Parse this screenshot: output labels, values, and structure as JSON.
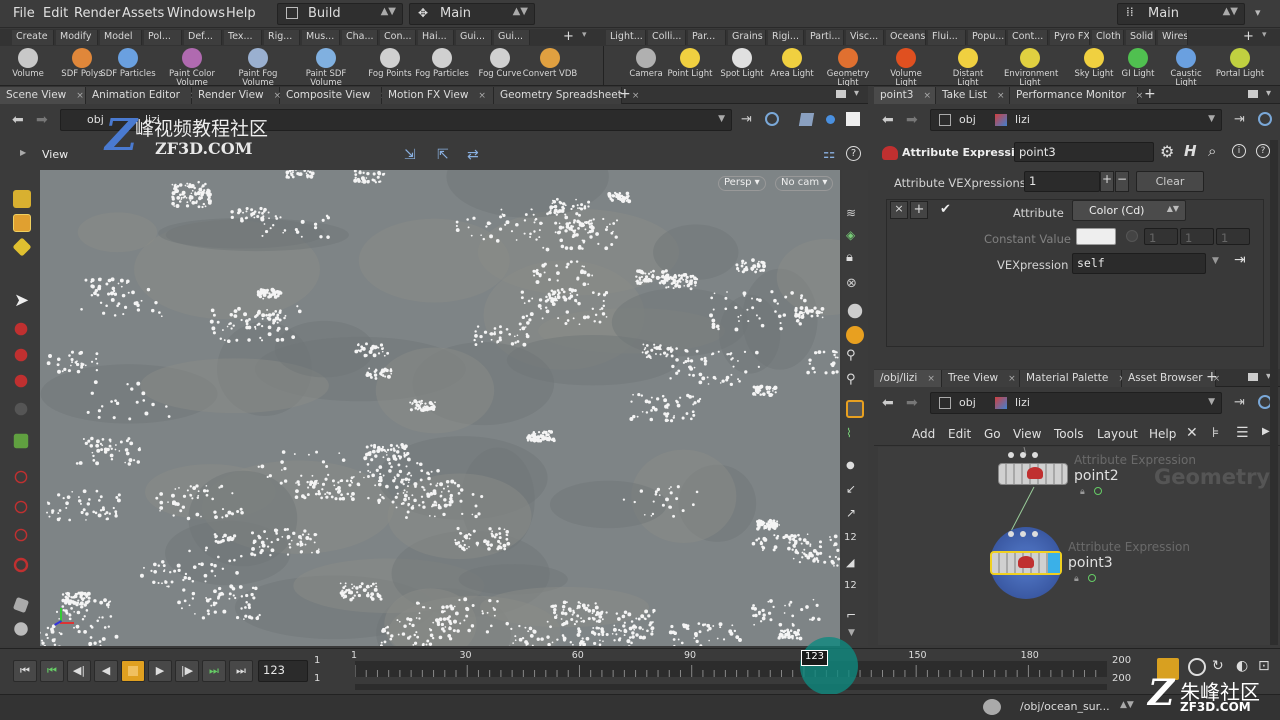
{
  "menubar": {
    "items": [
      "File",
      "Edit",
      "Render",
      "Assets",
      "Windows",
      "Help"
    ],
    "desktop": "Build",
    "context": "Main",
    "right": "Main"
  },
  "shelf_tabs_left": [
    "Create",
    "Modify",
    "Model",
    "Pol...",
    "Def...",
    "Tex...",
    "Rig...",
    "Mus...",
    "Cha...",
    "Con...",
    "Hai...",
    "Gui...",
    "Gui..."
  ],
  "shelf_tabs_right": [
    "Light...",
    "Colli...",
    "Par...",
    "Grains",
    "Rigi...",
    "Parti...",
    "Visc...",
    "Oceans",
    "Flui...",
    "Popu...",
    "Cont...",
    "Pyro FX",
    "Cloth",
    "Solid",
    "Wires"
  ],
  "tools_left": [
    {
      "label": "Volume",
      "color": "#c8c8c8"
    },
    {
      "label": "SDF Polys",
      "color": "#e0873a"
    },
    {
      "label": "SDF Particles",
      "color": "#6aa0e0"
    },
    {
      "label": "Paint Color Volume",
      "color": "#b06ab0"
    },
    {
      "label": "Paint Fog Volume",
      "color": "#9ab0d0"
    },
    {
      "label": "Paint SDF Volume",
      "color": "#80b0e0"
    },
    {
      "label": "Fog Points",
      "color": "#d0d0d0"
    },
    {
      "label": "Fog Particles",
      "color": "#d0d0d0"
    },
    {
      "label": "Fog Curve",
      "color": "#d0d0d0"
    },
    {
      "label": "Convert VDB",
      "color": "#e0a040"
    }
  ],
  "tools_right": [
    {
      "label": "Camera",
      "color": "#b0b0b0"
    },
    {
      "label": "Point Light",
      "color": "#f0d040"
    },
    {
      "label": "Spot Light",
      "color": "#e0e0e0"
    },
    {
      "label": "Area Light",
      "color": "#f0d040"
    },
    {
      "label": "Geometry Light",
      "color": "#e07030"
    },
    {
      "label": "Volume Light",
      "color": "#e05020"
    },
    {
      "label": "Distant Light",
      "color": "#f0d040"
    },
    {
      "label": "Environment Light",
      "color": "#e0d040"
    },
    {
      "label": "Sky Light",
      "color": "#f0d040"
    },
    {
      "label": "GI Light",
      "color": "#50c050"
    },
    {
      "label": "Caustic Light",
      "color": "#6aa0e0"
    },
    {
      "label": "Portal Light",
      "color": "#c0d040"
    }
  ],
  "left_pane": {
    "tabs": [
      "Scene View",
      "Animation Editor",
      "Render View",
      "Composite View",
      "Motion FX View",
      "Geometry Spreadsheet"
    ],
    "path": [
      "obj",
      "lizi"
    ],
    "view_label": "View",
    "persp": "Persp",
    "cam": "No cam"
  },
  "watermark": {
    "top": "峰视频教程社区",
    "sub": "ZF3D.COM",
    "bottom": "朱峰社区",
    "bottom_sub": "ZF3D.COM"
  },
  "param_pane": {
    "tabs": [
      "point3",
      "Take List",
      "Performance Monitor"
    ],
    "path": [
      "obj",
      "lizi"
    ],
    "node_type": "Attribute Expression",
    "node_name": "point3",
    "vex_label": "Attribute VEXpressions",
    "vex_count": "1",
    "clear": "Clear",
    "attribute_label": "Attribute",
    "attribute_value": "Color (Cd)",
    "constant_label": "Constant Value",
    "constant_vals": [
      "1",
      "1",
      "1"
    ],
    "vexpression_label": "VEXpression",
    "vexpression_value": "self"
  },
  "network_pane": {
    "tabs": [
      "/obj/lizi",
      "Tree View",
      "Material Palette",
      "Asset Browser"
    ],
    "path": [
      "obj",
      "lizi"
    ],
    "menu": [
      "Add",
      "Edit",
      "Go",
      "View",
      "Tools",
      "Layout",
      "Help"
    ],
    "watermark": "Geometry",
    "nodes": [
      {
        "type": "Attribute Expression",
        "name": "point2"
      },
      {
        "type": "Attribute Expression",
        "name": "point3"
      }
    ]
  },
  "timeline": {
    "frame": "123",
    "start": "1",
    "start2": "1",
    "end": "200",
    "end2": "200",
    "ticks": [
      "1",
      "30",
      "60",
      "90",
      "123",
      "150",
      "180"
    ]
  },
  "status": {
    "path": "/obj/ocean_sur..."
  }
}
